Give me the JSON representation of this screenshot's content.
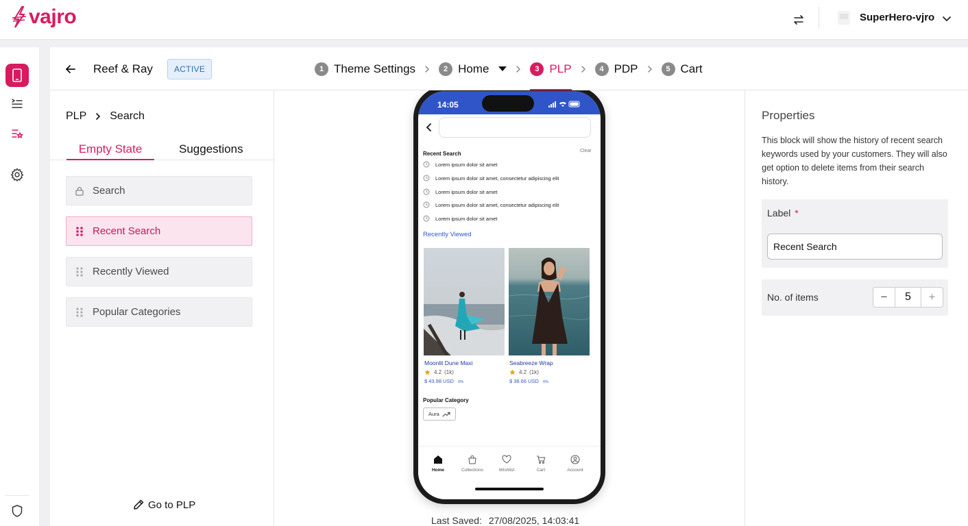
{
  "header": {
    "logo_text": "vajro",
    "store_name": "SuperHero-vjro"
  },
  "colors": {
    "brand": "#d81b60",
    "accent_blue": "#2f55c8",
    "badge_bg": "#e5effb"
  },
  "rail": {
    "items": [
      {
        "icon": "mobile-icon",
        "active": true
      },
      {
        "icon": "menu-list-icon",
        "active": false
      },
      {
        "icon": "starred-list-icon",
        "active": false
      },
      {
        "icon": "gear-icon",
        "active": false
      },
      {
        "icon": "shield-icon",
        "active": false
      }
    ]
  },
  "panel": {
    "store_title": "Reef & Ray",
    "status": "ACTIVE",
    "steps": [
      {
        "num": "1",
        "label": "Theme Settings"
      },
      {
        "num": "2",
        "label": "Home"
      },
      {
        "num": "3",
        "label": "PLP"
      },
      {
        "num": "4",
        "label": "PDP"
      },
      {
        "num": "5",
        "label": "Cart"
      }
    ],
    "active_step": "PLP"
  },
  "left": {
    "breadcrumb": [
      "PLP",
      "Search"
    ],
    "tabs": [
      "Empty State",
      "Suggestions"
    ],
    "blocks": [
      {
        "label": "Search",
        "locked": true
      },
      {
        "label": "Recent Search",
        "selected": true
      },
      {
        "label": "Recently Viewed"
      },
      {
        "label": "Popular Categories"
      }
    ],
    "goto_label": "Go to PLP"
  },
  "preview": {
    "time": "14:05",
    "recent_title": "Recent Search",
    "clear_label": "Clear",
    "recent_items": [
      "Lorem ipsum dolor sit amet",
      "Lorem ipsum dolor sit amet, consectetur adipiscing elit",
      "Lorem ipsum dolor sit amet",
      "Lorem ipsum dolor sit amet, consectetur adipiscing elit",
      "Lorem ipsum dolor sit amet"
    ],
    "recently_viewed_title": "Recently Viewed",
    "products": [
      {
        "name": "Moonlit Dune Maxi",
        "rating": "4.2",
        "reviews": "(1k)",
        "price": "$ 43.98 USD",
        "discount": "0%"
      },
      {
        "name": "Seabreeze Wrap",
        "rating": "4.2",
        "reviews": "(1k)",
        "price": "$ 38.66 USD",
        "discount": "0%"
      }
    ],
    "popular_title": "Popular Category",
    "chip": "Aura",
    "tabbar": [
      "Home",
      "Collections",
      "Wishlist",
      "Cart",
      "Account"
    ],
    "last_saved_label": "Last Saved:",
    "last_saved_value": "27/08/2025, 14:03:41"
  },
  "properties": {
    "title": "Properties",
    "description": "This block will show the history of recent search keywords used by your customers. They will also get option to delete items from their search history.",
    "label_title": "Label",
    "required_mark": "*",
    "label_value": "Recent Search",
    "items_title": "No. of items",
    "items_value": "5",
    "minus": "−",
    "plus": "+"
  }
}
